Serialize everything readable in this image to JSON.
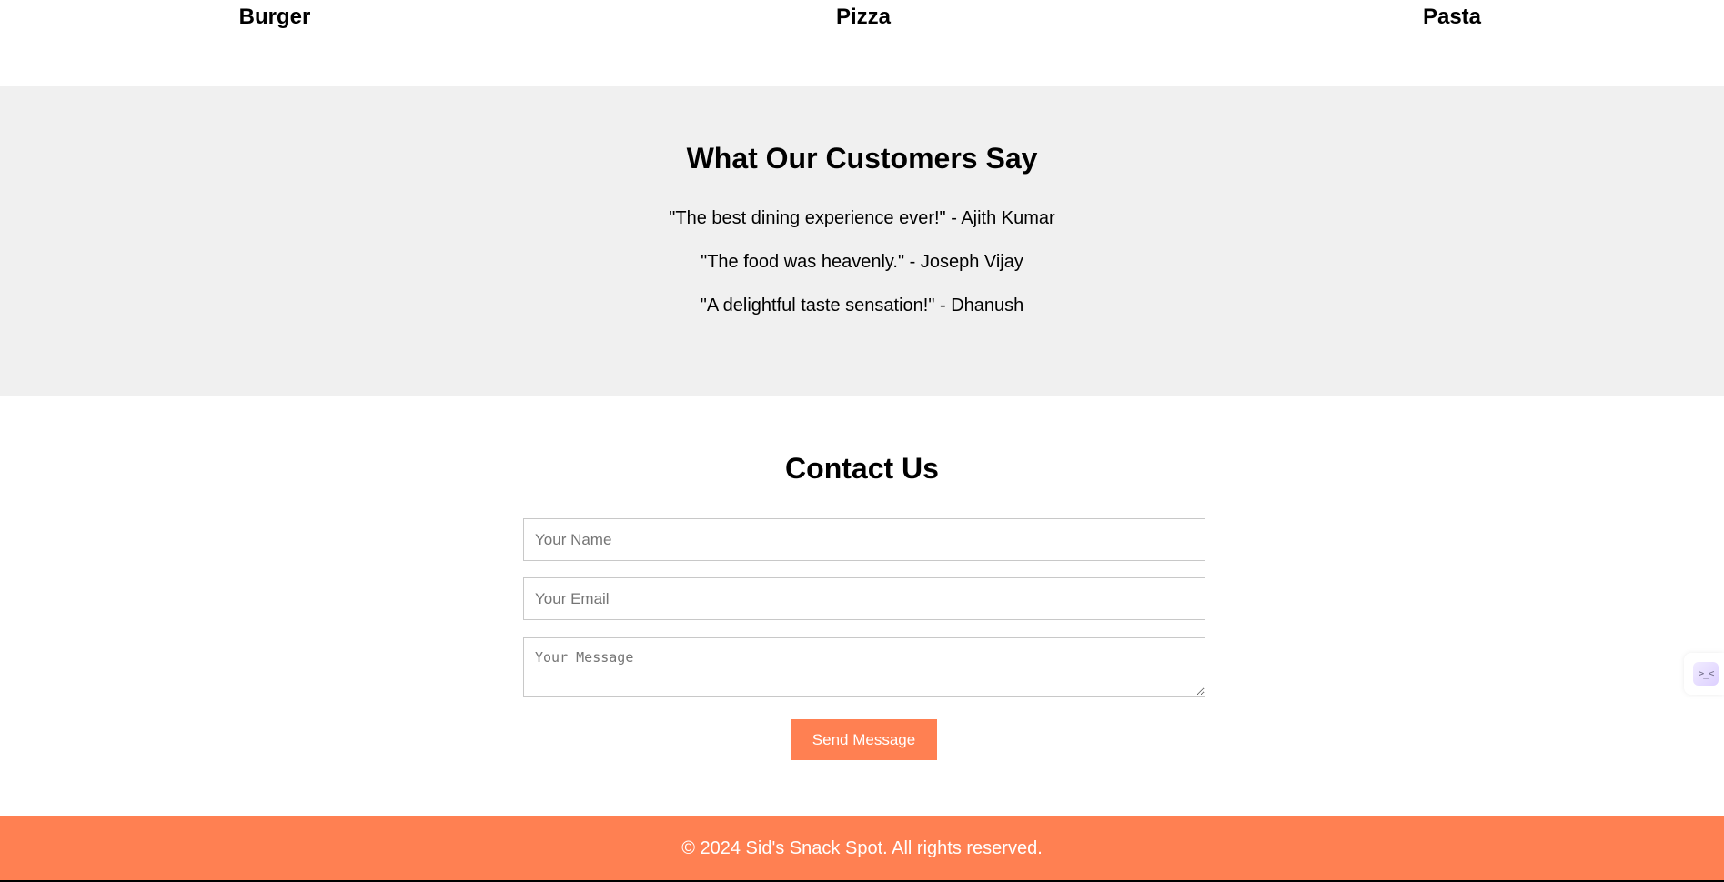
{
  "menu": {
    "items": [
      {
        "label": "Burger"
      },
      {
        "label": "Pizza"
      },
      {
        "label": "Pasta"
      }
    ]
  },
  "testimonials": {
    "title": "What Our Customers Say",
    "items": [
      {
        "text": "\"The best dining experience ever!\" - Ajith Kumar"
      },
      {
        "text": "\"The food was heavenly.\" - Joseph Vijay"
      },
      {
        "text": "\"A delightful taste sensation!\" - Dhanush"
      }
    ]
  },
  "contact": {
    "title": "Contact Us",
    "name_placeholder": "Your Name",
    "email_placeholder": "Your Email",
    "message_placeholder": "Your Message",
    "submit_label": "Send Message"
  },
  "footer": {
    "text": "© 2024 Sid's Snack Spot. All rights reserved."
  },
  "side_widget": {
    "icon": "terminal-face-icon",
    "glyph": ">_<"
  },
  "colors": {
    "accent": "#ff8052",
    "section_bg": "#f0f0f0"
  }
}
